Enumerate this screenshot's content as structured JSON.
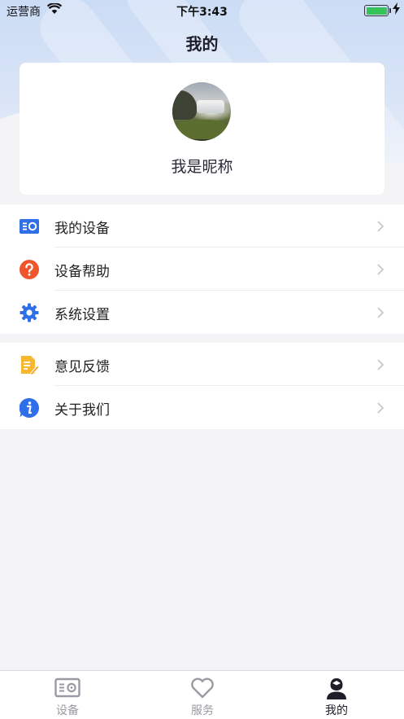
{
  "status_bar": {
    "carrier": "运营商",
    "time": "下午3:43",
    "battery_level": 1.0,
    "battery_color": "#35c35a",
    "wifi_icon": "wifi-icon",
    "charging_icon": "bolt-icon"
  },
  "header": {
    "title": "我的"
  },
  "profile": {
    "nickname": "我是昵称",
    "avatar_icon": "avatar-waterfall-photo"
  },
  "menu_groups": [
    {
      "items": [
        {
          "label": "我的设备",
          "icon": "device-icon",
          "icon_color": "#2f6fe8"
        },
        {
          "label": "设备帮助",
          "icon": "help-icon",
          "icon_color": "#f0542d"
        },
        {
          "label": "系统设置",
          "icon": "gear-icon",
          "icon_color": "#2f6fe8"
        }
      ]
    },
    {
      "items": [
        {
          "label": "意见反馈",
          "icon": "feedback-icon",
          "icon_color": "#f7b731"
        },
        {
          "label": "关于我们",
          "icon": "info-icon",
          "icon_color": "#2f6fe8"
        }
      ]
    }
  ],
  "tabbar": {
    "tabs": [
      {
        "label": "设备",
        "icon": "device-tab-icon",
        "active": false
      },
      {
        "label": "服务",
        "icon": "heart-icon",
        "active": false
      },
      {
        "label": "我的",
        "icon": "user-icon",
        "active": true
      }
    ],
    "active_color": "#1e1e2a",
    "inactive_color": "#9a9aa2"
  }
}
